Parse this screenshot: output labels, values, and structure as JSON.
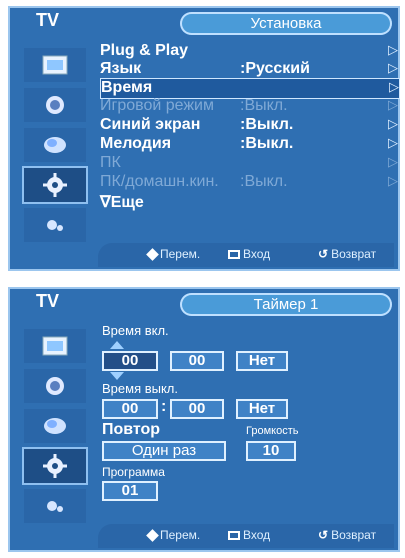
{
  "panel1": {
    "tv_label": "TV",
    "title": "Установка",
    "menu": [
      {
        "label": "Plug & Play",
        "value": "",
        "arrow": "▷",
        "state": "normal"
      },
      {
        "label": "Язык",
        "value": ":Русский",
        "arrow": "▷",
        "state": "normal"
      },
      {
        "label": "Время",
        "value": "",
        "arrow": "▷",
        "state": "highlighted"
      },
      {
        "label": "Игровой режим",
        "value": ":Выкл.",
        "arrow": "▷",
        "state": "dimmed"
      },
      {
        "label": "Синий экран",
        "value": ":Выкл.",
        "arrow": "▷",
        "state": "normal"
      },
      {
        "label": "Мелодия",
        "value": ":Выкл.",
        "arrow": "▷",
        "state": "normal"
      },
      {
        "label": "ПК",
        "value": "",
        "arrow": "▷",
        "state": "dimmed"
      },
      {
        "label": "ПК/домашн.кин.",
        "value": ":Выкл.",
        "arrow": "▷",
        "state": "dimmed"
      },
      {
        "label": "∇Еще",
        "value": "",
        "arrow": "",
        "state": "normal"
      }
    ],
    "bottom": {
      "move": "Перем.",
      "enter": "Вход",
      "return": "Возврат"
    }
  },
  "panel2": {
    "tv_label": "TV",
    "title": "Таймер 1",
    "on_time_label": "Время вкл.",
    "on_hour": "00",
    "on_min": "00",
    "on_state": "Нет",
    "off_time_label": "Время выкл.",
    "off_hour": "00",
    "colon": ":",
    "off_min": "00",
    "off_state": "Нет",
    "repeat_label": "Повтор",
    "repeat_value": "Один раз",
    "volume_label": "Громкость",
    "volume_value": "10",
    "program_label": "Программа",
    "program_value": "01",
    "bottom": {
      "move": "Перем.",
      "enter": "Вход",
      "return": "Возврат"
    }
  },
  "colors": {
    "panel": "#2f6fb2",
    "accent": "#4a9bd8"
  },
  "sidebar_icons": [
    "picture-icon",
    "sound-icon",
    "channel-icon",
    "setup-icon",
    "input-icon"
  ]
}
